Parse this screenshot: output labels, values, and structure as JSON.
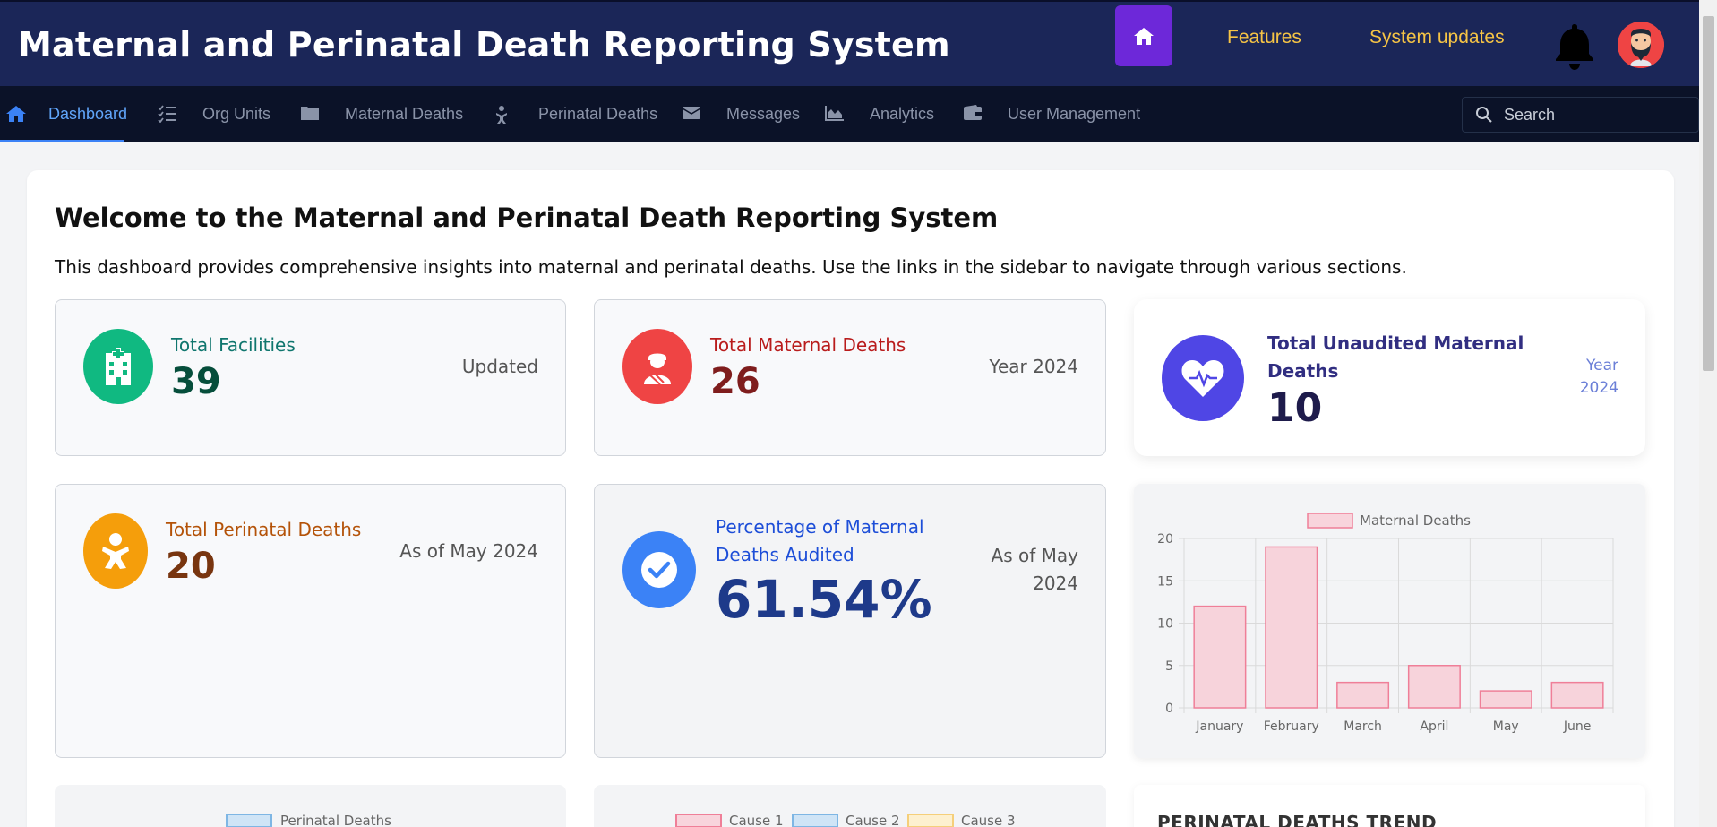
{
  "header": {
    "title": "Maternal and Perinatal Death Reporting System",
    "links": [
      "Features",
      "System updates"
    ]
  },
  "nav": {
    "items": [
      {
        "label": "Dashboard",
        "icon": "home-icon"
      },
      {
        "label": "Org Units",
        "icon": "list-check-icon"
      },
      {
        "label": "Maternal Deaths",
        "icon": "folder-icon"
      },
      {
        "label": "Perinatal Deaths",
        "icon": "baby-icon"
      },
      {
        "label": "Messages",
        "icon": "envelope-icon"
      },
      {
        "label": "Analytics",
        "icon": "area-chart-icon"
      },
      {
        "label": "User Management",
        "icon": "wallet-icon"
      }
    ],
    "search_placeholder": "Search"
  },
  "welcome": {
    "title": "Welcome to the Maternal and Perinatal Death Reporting System",
    "text": "This dashboard provides comprehensive insights into maternal and perinatal deaths. Use the links in the sidebar to navigate through various sections."
  },
  "stats": {
    "facilities": {
      "label": "Total Facilities",
      "value": "39",
      "note": "Updated",
      "color": "#10b981"
    },
    "maternal": {
      "label": "Total Maternal Deaths",
      "value": "26",
      "note": "Year 2024",
      "color": "#ef4444"
    },
    "unaudited": {
      "label_line1": "Total Unaudited Maternal",
      "label_line2": "Deaths",
      "value": "10",
      "note_line1": "Year",
      "note_line2": "2024",
      "color": "#4f46e5"
    },
    "perinatal": {
      "label": "Total Perinatal Deaths",
      "value": "20",
      "note": "As of May 2024",
      "color": "#f59e0b"
    },
    "audited": {
      "label_line1": "Percentage of Maternal",
      "label_line2": "Deaths Audited",
      "value": "61.54%",
      "note_line1": "As of May",
      "note_line2": "2024",
      "color": "#3b82f6"
    }
  },
  "chart_data": {
    "type": "bar",
    "categories": [
      "January",
      "February",
      "March",
      "April",
      "May",
      "June"
    ],
    "series": [
      {
        "name": "Maternal Deaths",
        "values": [
          12,
          19,
          3,
          5,
          2,
          3
        ]
      }
    ],
    "ylim": [
      0,
      20
    ],
    "yticks": [
      0,
      5,
      10,
      15,
      20
    ],
    "grid": true,
    "legend": "top"
  },
  "lower": {
    "perinatal_legend": "Perinatal Deaths",
    "cause_legends": [
      "Cause 1",
      "Cause 2",
      "Cause 3"
    ],
    "trend_title": "PERINATAL DEATHS TREND"
  }
}
